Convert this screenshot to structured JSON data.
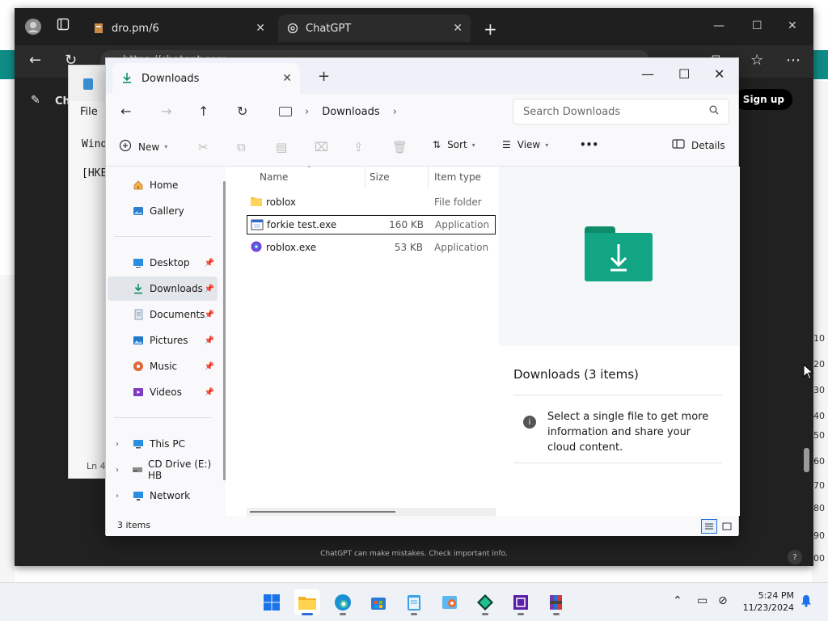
{
  "browser": {
    "tabs": [
      {
        "label": "dro.pm/6",
        "icon": "pdf-file-icon"
      },
      {
        "label": "ChatGPT",
        "icon": "openai-logo-icon"
      }
    ],
    "address_text": "https://chatgpt.com",
    "page_title_fragment": "Ch",
    "signup_label": "Sign up",
    "disclaimer": "ChatGPT can make mistakes. Check important info.",
    "help_label": "?"
  },
  "background_page": {
    "right_numbers": [
      "10",
      "20",
      "30",
      "40",
      "50",
      "60",
      "70",
      "80",
      "90",
      "00"
    ]
  },
  "notepad": {
    "menu_file": "File",
    "line1": "Wind",
    "line2": "[HKE",
    "status": "Ln 4"
  },
  "explorer": {
    "tab_label": "Downloads",
    "breadcrumb": "Downloads",
    "search_placeholder": "Search Downloads",
    "cmd": {
      "new_label": "New",
      "sort_label": "Sort",
      "view_label": "View",
      "more_label": "•••",
      "details_label": "Details"
    },
    "nav": {
      "top": [
        {
          "label": "Home",
          "icon": "home-icon"
        },
        {
          "label": "Gallery",
          "icon": "gallery-icon"
        }
      ],
      "quick": [
        {
          "label": "Desktop",
          "icon": "desktop-icon",
          "selected": false
        },
        {
          "label": "Downloads",
          "icon": "downloads-icon",
          "selected": true
        },
        {
          "label": "Documents",
          "icon": "documents-icon",
          "selected": false
        },
        {
          "label": "Pictures",
          "icon": "pictures-icon",
          "selected": false
        },
        {
          "label": "Music",
          "icon": "music-icon",
          "selected": false
        },
        {
          "label": "Videos",
          "icon": "videos-icon",
          "selected": false
        }
      ],
      "drives": [
        {
          "label": "This PC",
          "icon": "this-pc-icon"
        },
        {
          "label": "CD Drive (E:) HB",
          "icon": "cd-drive-icon"
        },
        {
          "label": "Network",
          "icon": "network-icon"
        }
      ]
    },
    "columns": {
      "name": "Name",
      "size": "Size",
      "type": "Item type"
    },
    "files": [
      {
        "name": "roblox",
        "size": "",
        "type": "File folder",
        "icon": "folder-icon",
        "focused": false
      },
      {
        "name": "forkie test.exe",
        "size": "160 KB",
        "type": "Application",
        "icon": "exe-app-icon",
        "focused": true
      },
      {
        "name": "roblox.exe",
        "size": "53 KB",
        "type": "Application",
        "icon": "roblox-app-icon",
        "focused": false
      }
    ],
    "preview": {
      "title": "Downloads (3 items)",
      "info": "Select a single file to get more information and share your cloud content."
    },
    "status_count": "3 items"
  },
  "taskbar": {
    "apps": [
      {
        "name": "start-button",
        "icon": "windows-logo-icon",
        "active": false
      },
      {
        "name": "file-explorer-app",
        "icon": "file-explorer-icon",
        "active": true
      },
      {
        "name": "edge-app",
        "icon": "edge-icon",
        "active": false
      },
      {
        "name": "store-app",
        "icon": "store-icon",
        "active": false
      },
      {
        "name": "notepad-app",
        "icon": "notepad-icon",
        "active": false
      },
      {
        "name": "media-app",
        "icon": "media-icon",
        "active": false
      },
      {
        "name": "green-diamond-app",
        "icon": "diamond-icon",
        "active": false
      },
      {
        "name": "purple-chip-app",
        "icon": "chip-icon",
        "active": false
      },
      {
        "name": "archive-app",
        "icon": "archive-icon",
        "active": false
      }
    ],
    "time": "5:24 PM",
    "date": "11/23/2024"
  },
  "colors": {
    "accent": "#0e8c86",
    "folder_teal": "#11a584",
    "selection_blue": "#2a6fd6"
  }
}
